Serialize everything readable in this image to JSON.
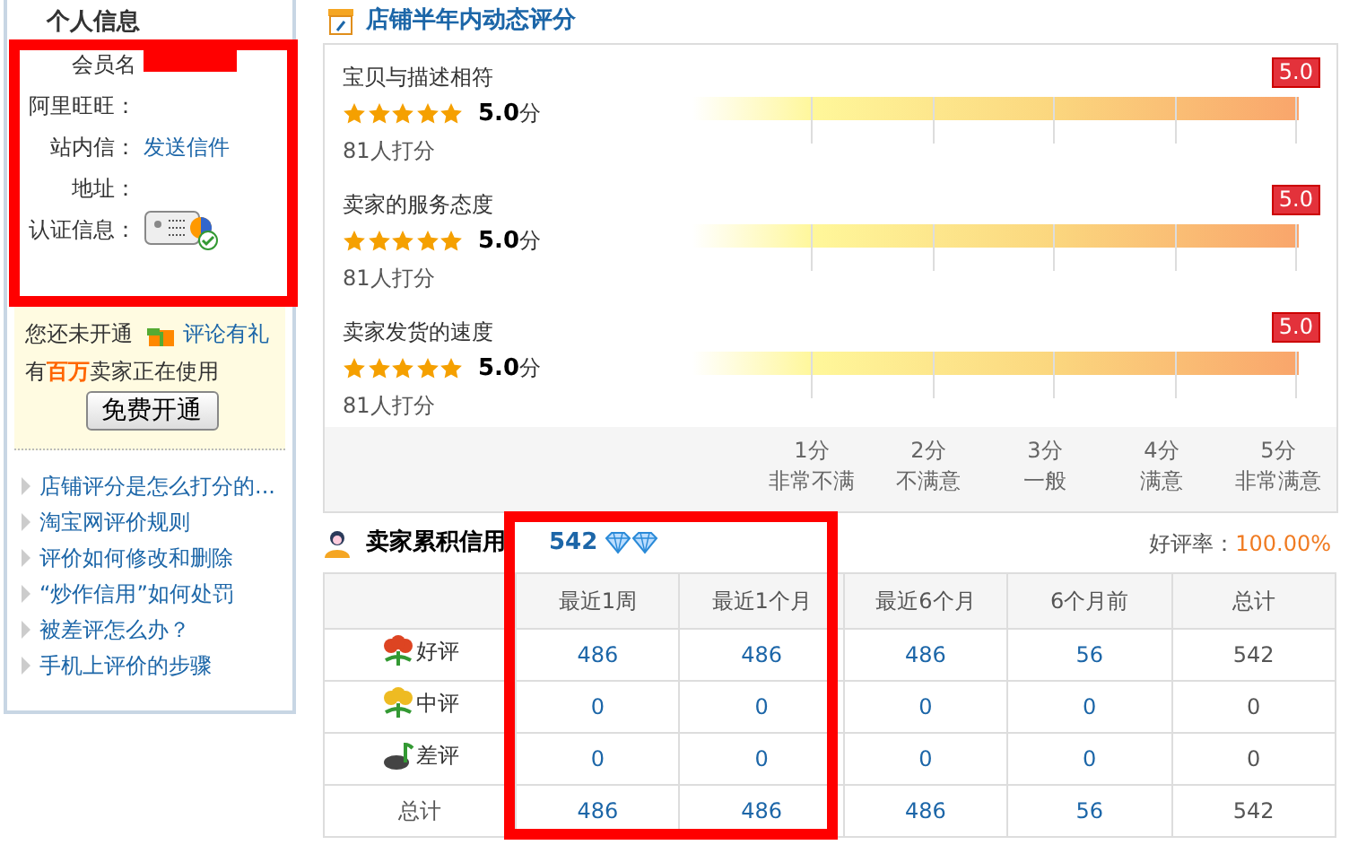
{
  "sidebar": {
    "title": "个人信息",
    "info_rows": [
      {
        "label": "会员名",
        "kind": "redacted"
      },
      {
        "label": "阿里旺旺：",
        "kind": "empty"
      },
      {
        "label": "站内信：",
        "kind": "link",
        "value": "发送信件"
      },
      {
        "label": "地址：",
        "kind": "empty"
      },
      {
        "label": "认证信息：",
        "kind": "badge"
      }
    ],
    "promo": {
      "line1": "您还未开通",
      "link": "评论有礼",
      "line2": "有**百万**卖家正在使用",
      "button": "免费开通"
    },
    "links": [
      "店铺评分是怎么打分的...",
      "淘宝网评价规则",
      "评价如何修改和删除",
      "“炒作信用”如何处罚",
      "被差评怎么办？",
      "手机上评价的步骤"
    ]
  },
  "ratings": {
    "title": "店铺半年内动态评分",
    "items": [
      {
        "name": "宝贝与描述相符",
        "stars": 5,
        "score": "5.0",
        "unit": "分",
        "count": "81人打分",
        "badge": "5.0"
      },
      {
        "name": "卖家的服务态度",
        "stars": 5,
        "score": "5.0",
        "unit": "分",
        "count": "81人打分",
        "badge": "5.0"
      },
      {
        "name": "卖家发货的速度",
        "stars": 5,
        "score": "5.0",
        "unit": "分",
        "count": "81人打分",
        "badge": "5.0"
      }
    ],
    "scale": [
      {
        "score": "1分",
        "label": "非常不满"
      },
      {
        "score": "2分",
        "label": "不满意"
      },
      {
        "score": "3分",
        "label": "一般"
      },
      {
        "score": "4分",
        "label": "满意"
      },
      {
        "score": "5分",
        "label": "非常满意"
      }
    ]
  },
  "credit": {
    "title": "卖家累积信用",
    "points": "542",
    "rank_icons": [
      {
        "kind": "diamond"
      },
      {
        "kind": "diamond"
      }
    ],
    "rate_label": "好评率：",
    "rate": "100.00%",
    "columns": [
      "最近1周",
      "最近1个月",
      "最近6个月",
      "6个月前",
      "总计"
    ],
    "rows": [
      {
        "kind": "good",
        "label": "好评",
        "cells": [
          "486",
          "486",
          "486",
          "56",
          "542"
        ]
      },
      {
        "kind": "neutral",
        "label": "中评",
        "cells": [
          "0",
          "0",
          "0",
          "0",
          "0"
        ]
      },
      {
        "kind": "bad",
        "label": "差评",
        "cells": [
          "0",
          "0",
          "0",
          "0",
          "0"
        ]
      },
      {
        "kind": "total",
        "label": "总计",
        "cells": [
          "486",
          "486",
          "486",
          "56",
          "542"
        ]
      }
    ]
  }
}
